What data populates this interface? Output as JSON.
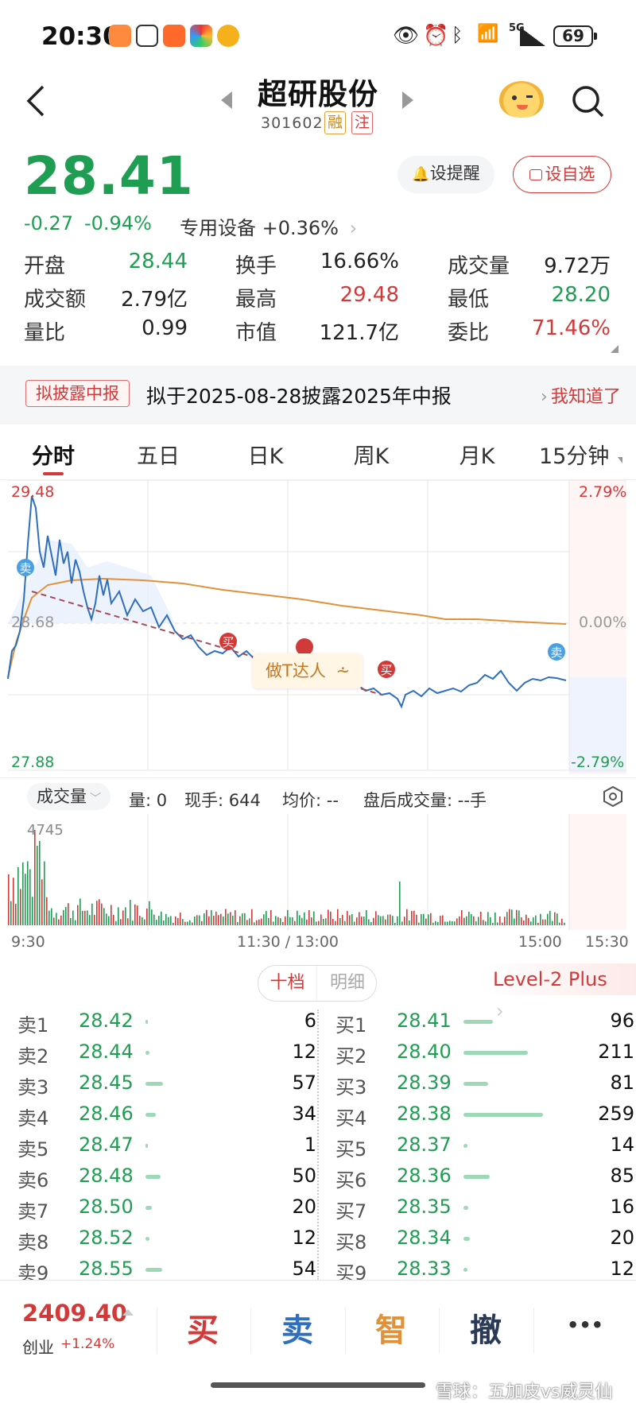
{
  "status_bar": {
    "time": "20:30",
    "network": "5G",
    "battery": "69"
  },
  "header": {
    "title": "超研股份",
    "code": "301602",
    "badge_margin": "融",
    "badge_watch": "注"
  },
  "quote": {
    "price": "28.41",
    "change": "-0.27",
    "change_pct": "-0.94%",
    "sector": "专用设备 +0.36%",
    "alert_label": "设提醒",
    "watch_label": "设自选"
  },
  "stats": [
    [
      {
        "label": "开盘",
        "value": "28.44",
        "color": "green"
      },
      {
        "label": "换手",
        "value": "16.66%",
        "color": "black"
      },
      {
        "label": "成交量",
        "value": "9.72万",
        "color": "black"
      }
    ],
    [
      {
        "label": "成交额",
        "value": "2.79亿",
        "color": "black"
      },
      {
        "label": "最高",
        "value": "29.48",
        "color": "red"
      },
      {
        "label": "最低",
        "value": "28.20",
        "color": "green"
      }
    ],
    [
      {
        "label": "量比",
        "value": "0.99",
        "color": "black"
      },
      {
        "label": "市值",
        "value": "121.7亿",
        "color": "black"
      },
      {
        "label": "委比",
        "value": "71.46%",
        "color": "red"
      }
    ]
  ],
  "banner": {
    "tag": "拟披露中报",
    "text": "拟于2025-08-28披露2025年中报",
    "action": "我知道了"
  },
  "tabs": [
    "分时",
    "五日",
    "日K",
    "周K",
    "月K",
    "15分钟"
  ],
  "chart": {
    "y_high": "29.48",
    "y_mid": "28.68",
    "y_low": "27.88",
    "pct_high": "2.79%",
    "pct_mid": "0.00%",
    "pct_low": "-2.79%",
    "overlay_label": "做T达人",
    "buy_marker": "买",
    "sell_marker": "卖"
  },
  "volume_bar": {
    "selector": "成交量",
    "qty": "量: 0",
    "current": "现手: 644",
    "avg": "均价: --",
    "after_hours": "盘后成交量: --手",
    "peak": "4745"
  },
  "time_axis": {
    "start": "9:30",
    "mid": "11:30 / 13:00",
    "end": "15:00",
    "after": "15:30"
  },
  "orderbook": {
    "tab_active": "十档",
    "tab_inactive": "明细",
    "level_label": "Level-2 Plus",
    "sells": [
      {
        "label": "卖1",
        "price": "28.42",
        "qty": "6"
      },
      {
        "label": "卖2",
        "price": "28.44",
        "qty": "12"
      },
      {
        "label": "卖3",
        "price": "28.45",
        "qty": "57"
      },
      {
        "label": "卖4",
        "price": "28.46",
        "qty": "34"
      },
      {
        "label": "卖5",
        "price": "28.47",
        "qty": "1"
      },
      {
        "label": "卖6",
        "price": "28.48",
        "qty": "50"
      },
      {
        "label": "卖7",
        "price": "28.50",
        "qty": "20"
      },
      {
        "label": "卖8",
        "price": "28.52",
        "qty": "12"
      },
      {
        "label": "卖9",
        "price": "28.55",
        "qty": "54"
      }
    ],
    "buys": [
      {
        "label": "买1",
        "price": "28.41",
        "qty": "96"
      },
      {
        "label": "买2",
        "price": "28.40",
        "qty": "211"
      },
      {
        "label": "买3",
        "price": "28.39",
        "qty": "81"
      },
      {
        "label": "买4",
        "price": "28.38",
        "qty": "259"
      },
      {
        "label": "买5",
        "price": "28.37",
        "qty": "14"
      },
      {
        "label": "买6",
        "price": "28.36",
        "qty": "85"
      },
      {
        "label": "买7",
        "price": "28.35",
        "qty": "16"
      },
      {
        "label": "买8",
        "price": "28.34",
        "qty": "20"
      },
      {
        "label": "买9",
        "price": "28.33",
        "qty": "12"
      }
    ]
  },
  "bottom_bar": {
    "index_value": "2409.40",
    "index_name": "创业",
    "index_change": "+1.24%",
    "buy": "买",
    "sell": "卖",
    "smart": "智",
    "cancel": "撤",
    "more": "•••"
  },
  "watermark": "雪球：五加皮vs威灵仙",
  "colors": {
    "up": "#d23a3a",
    "down": "#1f9e53",
    "price_line": "#2f6fbd",
    "avg_line": "#e0923a"
  }
}
